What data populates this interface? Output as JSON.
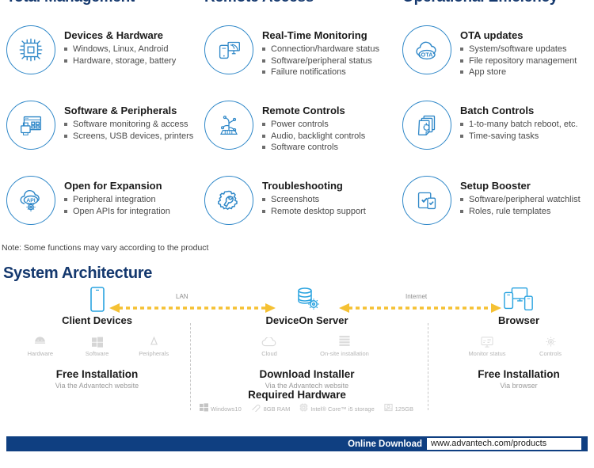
{
  "columns": [
    {
      "heading": "Total Management"
    },
    {
      "heading": "Remote Access"
    },
    {
      "heading": "Operational Efficiency"
    }
  ],
  "features": [
    [
      {
        "icon": "chip-icon",
        "title": "Devices & Hardware",
        "bullets": [
          "Windows, Linux, Android",
          "Hardware, storage, battery"
        ]
      },
      {
        "icon": "monitor-printer-icon",
        "title": "Real-Time Monitoring",
        "bullets": [
          "Connection/hardware status",
          "Software/peripheral status",
          "Failure notifications"
        ]
      },
      {
        "icon": "ota-cloud-icon",
        "title": "OTA updates",
        "bullets": [
          "System/software updates",
          "File repository management",
          "App store"
        ]
      }
    ],
    [
      {
        "icon": "software-peripherals-icon",
        "title": "Software & Peripherals",
        "bullets": [
          "Software monitoring & access",
          "Screens, USB devices, printers"
        ]
      },
      {
        "icon": "circuit-controls-icon",
        "title": "Remote Controls",
        "bullets": [
          "Power controls",
          "Audio, backlight controls",
          "Software controls"
        ]
      },
      {
        "icon": "stacked-documents-icon",
        "title": "Batch Controls",
        "bullets": [
          "1-to-many batch reboot, etc.",
          "Time-saving tasks"
        ]
      }
    ],
    [
      {
        "icon": "api-cloud-gear-icon",
        "title": "Open for Expansion",
        "bullets": [
          "Peripheral integration",
          "Open APIs for integration"
        ]
      },
      {
        "icon": "gear-wrench-icon",
        "title": "Troubleshooting",
        "bullets": [
          "Screenshots",
          "Remote desktop support"
        ]
      },
      {
        "icon": "checklist-devices-icon",
        "title": "Setup Booster",
        "bullets": [
          "Software/peripheral watchlist",
          "Roles, rule templates"
        ]
      }
    ]
  ],
  "note": "Note: Some functions may vary according to the product",
  "architecture": {
    "title": "System Architecture",
    "nodes": [
      {
        "id": "client-devices",
        "icon": "tablet-icon",
        "title": "Client Devices",
        "sub_items": [
          {
            "icon": "android-icon",
            "label": "Hardware"
          },
          {
            "icon": "windows-icon",
            "label": "Software"
          },
          {
            "icon": "linux-icon",
            "label": "Peripherals"
          }
        ],
        "install_title": "Free Installation",
        "install_sub": "Via the Advantech website"
      },
      {
        "id": "deviceon-server",
        "icon": "database-gear-icon",
        "title": "DeviceOn Server",
        "sub_items": [
          {
            "icon": "cloud-icon",
            "label": "Cloud"
          },
          {
            "icon": "server-rack-icon",
            "label": "On-site installation"
          }
        ],
        "install_title": "Download Installer",
        "install_sub": "Via the Advantech website"
      },
      {
        "id": "browser",
        "icon": "devices-browser-icon",
        "title": "Browser",
        "sub_items": [
          {
            "icon": "monitor-status-icon",
            "label": "Monitor status"
          },
          {
            "icon": "gear-controls-icon",
            "label": "Controls"
          }
        ],
        "install_title": "Free Installation",
        "install_sub": "Via browser"
      }
    ],
    "connections": [
      {
        "id": "lan-link",
        "label": "LAN"
      },
      {
        "id": "internet-link",
        "label": "Internet"
      }
    ],
    "required_hardware": {
      "title": "Required Hardware",
      "items": [
        {
          "icon": "windows-logo-icon",
          "label": "Windows10"
        },
        {
          "icon": "ram-stick-icon",
          "label": "8GB RAM"
        },
        {
          "icon": "cpu-icon",
          "label": "Intel® Core™ i5 storage"
        },
        {
          "icon": "hdd-icon",
          "label": "125GB"
        }
      ]
    }
  },
  "footer": {
    "download_label": "Online Download",
    "url": "www.advantech.com/products"
  },
  "colors": {
    "brand_dark_blue": "#14386e",
    "icon_blue": "#2e87c8",
    "arrow_yellow": "#f5c133",
    "bar_blue": "#0f3f81"
  }
}
